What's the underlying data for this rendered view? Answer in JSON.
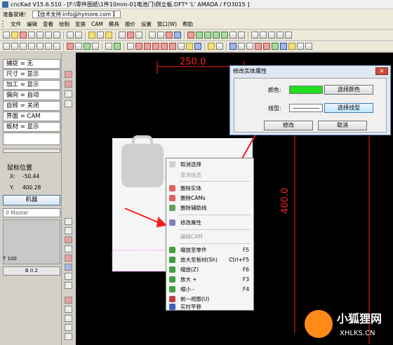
{
  "window": {
    "title": "cncKad V15.6.510 - [F:\\零件图纸\\1件10mm-01电池门\\侧立板.DFT*  'L'  AMADA / FO3015          ]",
    "status": "准备就绪！",
    "support": "【技术支持:info@hymore.com  】"
  },
  "menu": [
    "文件",
    "编辑",
    "查看",
    "绘制",
    "变换",
    "CAM",
    "模具",
    "报价",
    "设置",
    "窗口(W)",
    "帮助"
  ],
  "left_panel": {
    "props": [
      "捕捉 = 无",
      "尺寸 = 显示",
      "加工 = 显示",
      "偏向 = 自动",
      "自转 = 关闭",
      "界面 = CAM",
      "板材 = 显示"
    ],
    "mouse_label": "鼠标位置",
    "x_label": "X:",
    "x_value": "-50.44",
    "y_label": "Y:",
    "y_value": "400.28",
    "machine_button": "机器",
    "master": "0 Master",
    "tool_label": "T 100",
    "tool_name": "B 0.2"
  },
  "canvas": {
    "dim_top": "250.0",
    "dim_right": "400.0",
    "colors": {
      "dim": "#ff0000",
      "accent": "#ff3030"
    }
  },
  "dialog": {
    "title": "修改实体属性",
    "close": "✕",
    "color_label": "颜色:",
    "line_label": "线型:",
    "color_value": "#22dd22",
    "choose_color": "选择颜色",
    "choose_line": "选择线型",
    "modify": "修改",
    "cancel": "取消"
  },
  "context_menu": {
    "items": [
      {
        "label": "取消选择",
        "shortcut": "",
        "disabled": false
      },
      {
        "label": "查询信息",
        "shortcut": "",
        "disabled": true
      },
      {
        "label": "删除实体",
        "shortcut": "",
        "disabled": false
      },
      {
        "label": "删除CAMs",
        "shortcut": "",
        "disabled": false
      },
      {
        "label": "删除辅助线",
        "shortcut": "",
        "disabled": false
      },
      {
        "label": "修改属性",
        "shortcut": "",
        "disabled": false
      },
      {
        "label": "编辑CAM",
        "shortcut": "",
        "disabled": true
      },
      {
        "label": "缩放至零件",
        "shortcut": "F5",
        "disabled": false
      },
      {
        "label": "放大至板材(Sh)",
        "shortcut": "Ctrl+F5",
        "disabled": false
      },
      {
        "label": "缩放(Z)",
        "shortcut": "F6",
        "disabled": false
      },
      {
        "label": "放大 +",
        "shortcut": "F3",
        "disabled": false
      },
      {
        "label": "缩小 -",
        "shortcut": "F4",
        "disabled": false
      },
      {
        "label": "前一视图(U)",
        "shortcut": "",
        "disabled": false
      },
      {
        "label": "实时平移",
        "shortcut": "",
        "disabled": false
      }
    ]
  },
  "watermark": {
    "cn": "小狐狸网",
    "en": "XHLKS.CN"
  }
}
